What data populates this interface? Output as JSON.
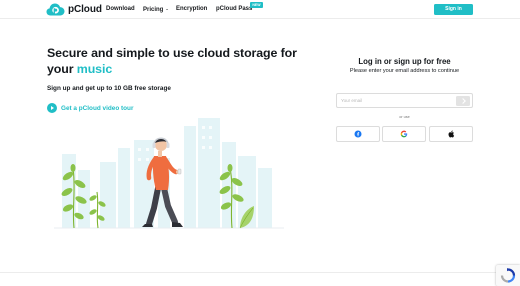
{
  "header": {
    "logo_text": "pCloud",
    "nav": [
      {
        "label": "Download",
        "has_dropdown": false
      },
      {
        "label": "Pricing",
        "has_dropdown": true
      },
      {
        "label": "Encryption",
        "has_dropdown": false
      },
      {
        "label": "pCloud Pass",
        "has_dropdown": false,
        "badge": "NEW"
      }
    ],
    "signin_label": "Sign in"
  },
  "hero": {
    "title_main": "Secure and simple to use cloud storage for your",
    "title_accent": "music",
    "subtitle": "Sign up and get up to 10 GB free storage",
    "video_link": "Get a pCloud video tour"
  },
  "login": {
    "title": "Log in or sign up for free",
    "subtitle": "Please enter your email address to continue",
    "email_placeholder": "Your email",
    "or_use": "or use",
    "social": [
      {
        "provider": "Facebook",
        "icon": "facebook-icon"
      },
      {
        "provider": "Google",
        "icon": "google-icon"
      },
      {
        "provider": "Apple",
        "icon": "apple-icon"
      }
    ]
  },
  "colors": {
    "brand": "#20bec6",
    "text": "#15191d",
    "shirt": "#ef6d3f",
    "plant": "#8bc34a",
    "city": "#e4f4f7"
  },
  "icons": {
    "recaptcha": "recaptcha-icon",
    "play": "play-icon"
  }
}
